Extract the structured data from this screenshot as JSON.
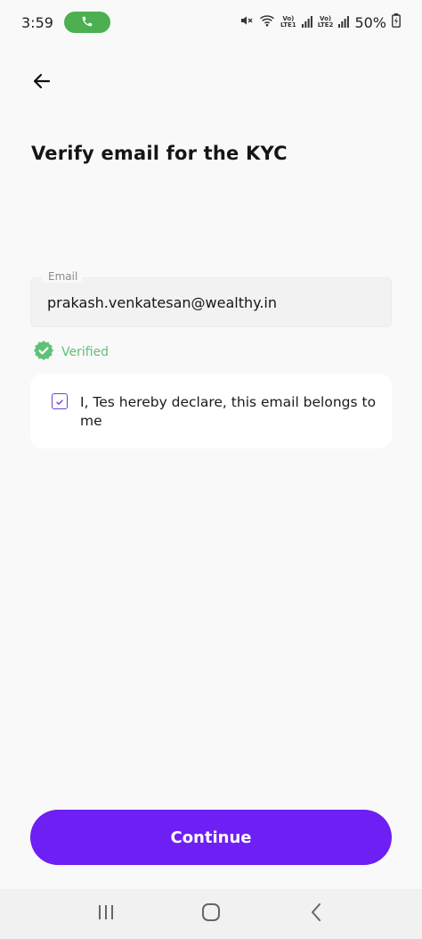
{
  "status_bar": {
    "time": "3:59",
    "network_1_top": "Vo)",
    "network_1_bottom": "LTE1",
    "network_2_top": "Vo)",
    "network_2_bottom": "LTE2",
    "battery": "50%"
  },
  "header": {
    "title": "Verify email for the KYC"
  },
  "email": {
    "label": "Email",
    "value": "prakash.venkatesan@wealthy.in"
  },
  "verification": {
    "status": "Verified",
    "color": "#5fc177"
  },
  "declaration": {
    "text": "I, Tes hereby declare, this email belongs to me",
    "checked": true
  },
  "actions": {
    "continue_label": "Continue",
    "accent": "#6e1ff3"
  },
  "icons": {
    "back": "back-arrow-icon",
    "verified": "verified-badge-icon",
    "phone": "phone-icon",
    "mute": "mute-icon",
    "wifi": "wifi-icon",
    "signal": "signal-icon",
    "battery": "battery-icon",
    "recents": "recents-icon",
    "home": "home-icon",
    "nav_back": "nav-back-icon"
  }
}
